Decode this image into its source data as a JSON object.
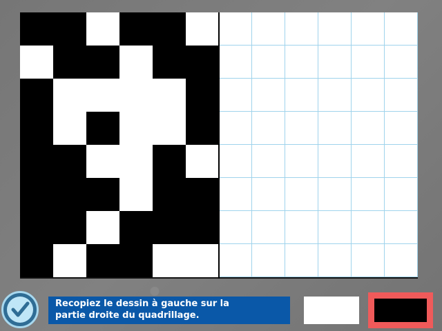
{
  "instruction": {
    "line1": "Recopiez le dessin à gauche sur la",
    "line2": "partie droite du quadrillage."
  },
  "colors": {
    "accent": "#0a58a8",
    "selected_outline": "#f05a5a",
    "grid_line": "#9fd3ec",
    "background": "#7a7a7a"
  },
  "palette": {
    "options": [
      "white",
      "black"
    ],
    "selected": "black"
  },
  "model_pattern": [
    [
      1,
      1,
      0,
      1,
      1,
      0
    ],
    [
      0,
      1,
      1,
      0,
      1,
      1
    ],
    [
      1,
      0,
      0,
      0,
      0,
      1
    ],
    [
      1,
      0,
      1,
      0,
      0,
      1
    ],
    [
      1,
      1,
      0,
      0,
      1,
      0
    ],
    [
      1,
      1,
      1,
      0,
      1,
      1
    ],
    [
      1,
      1,
      0,
      1,
      1,
      1
    ],
    [
      1,
      0,
      1,
      1,
      0,
      0
    ]
  ],
  "drawing_pattern": [
    [
      0,
      0,
      0,
      0,
      0,
      0
    ],
    [
      0,
      0,
      0,
      0,
      0,
      0
    ],
    [
      0,
      0,
      0,
      0,
      0,
      0
    ],
    [
      0,
      0,
      0,
      0,
      0,
      0
    ],
    [
      0,
      0,
      0,
      0,
      0,
      0
    ],
    [
      0,
      0,
      0,
      0,
      0,
      0
    ],
    [
      0,
      0,
      0,
      0,
      0,
      0
    ],
    [
      0,
      0,
      0,
      0,
      0,
      0
    ]
  ],
  "icons": {
    "check": "checkmark-icon"
  }
}
